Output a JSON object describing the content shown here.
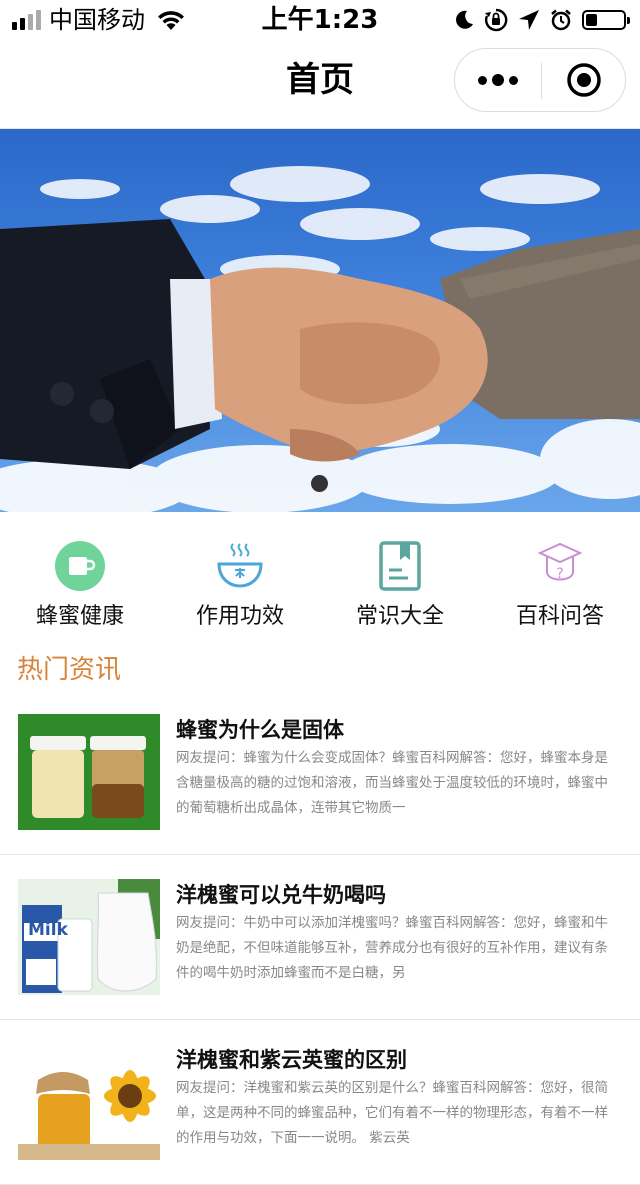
{
  "status_bar": {
    "carrier": "中国移动",
    "time": "上午1:23",
    "battery_level": 0.3
  },
  "nav": {
    "title": "首页"
  },
  "banner": {
    "slide_count": 1,
    "active_index": 0
  },
  "categories": [
    {
      "label": "蜂蜜健康",
      "icon": "cup-icon",
      "color": "#6fd39a"
    },
    {
      "label": "作用功效",
      "icon": "bowl-icon",
      "color": "#4aa7d8"
    },
    {
      "label": "常识大全",
      "icon": "book-icon",
      "color": "#5aa6a0"
    },
    {
      "label": "百科问答",
      "icon": "graduation-cap-icon",
      "color": "#c98fd4"
    }
  ],
  "section": {
    "title": "热门资讯"
  },
  "articles": [
    {
      "title": "蜂蜜为什么是固体",
      "desc": "网友提问：蜂蜜为什么会变成固体？蜂蜜百科网解答：您好，蜂蜜本身是含糖量极高的糖的过饱和溶液，而当蜂蜜处于温度较低的环境时，蜂蜜中的葡萄糖析出成晶体，连带其它物质一",
      "thumb": "honey-jars-image"
    },
    {
      "title": "洋槐蜜可以兑牛奶喝吗",
      "desc": "网友提问：牛奶中可以添加洋槐蜜吗？蜂蜜百科网解答：您好，蜂蜜和牛奶是绝配，不但味道能够互补，营养成分也有很好的互补作用，建议有条件的喝牛奶时添加蜂蜜而不是白糖，另",
      "thumb": "milk-image",
      "thumb_text": "Milk"
    },
    {
      "title": "洋槐蜜和紫云英蜜的区别",
      "desc": "网友提问：洋槐蜜和紫云英的区别是什么？蜂蜜百科网解答：您好，很简单，这是两种不同的蜂蜜品种，它们有着不一样的物理形态，有着不一样的作用与功效，下面一一说明。 紫云英",
      "thumb": "honey-sunflower-image"
    }
  ]
}
